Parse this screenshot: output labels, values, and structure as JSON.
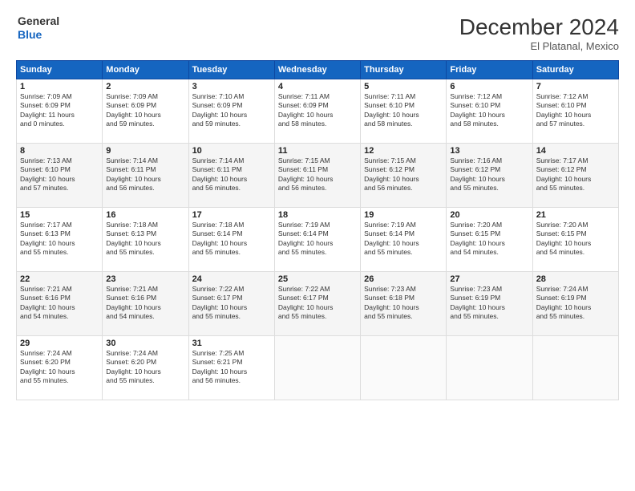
{
  "logo": {
    "line1": "General",
    "line2": "Blue"
  },
  "title": "December 2024",
  "location": "El Platanal, Mexico",
  "days_header": [
    "Sunday",
    "Monday",
    "Tuesday",
    "Wednesday",
    "Thursday",
    "Friday",
    "Saturday"
  ],
  "weeks": [
    [
      {
        "day": "1",
        "info": "Sunrise: 7:09 AM\nSunset: 6:09 PM\nDaylight: 11 hours\nand 0 minutes."
      },
      {
        "day": "2",
        "info": "Sunrise: 7:09 AM\nSunset: 6:09 PM\nDaylight: 10 hours\nand 59 minutes."
      },
      {
        "day": "3",
        "info": "Sunrise: 7:10 AM\nSunset: 6:09 PM\nDaylight: 10 hours\nand 59 minutes."
      },
      {
        "day": "4",
        "info": "Sunrise: 7:11 AM\nSunset: 6:09 PM\nDaylight: 10 hours\nand 58 minutes."
      },
      {
        "day": "5",
        "info": "Sunrise: 7:11 AM\nSunset: 6:10 PM\nDaylight: 10 hours\nand 58 minutes."
      },
      {
        "day": "6",
        "info": "Sunrise: 7:12 AM\nSunset: 6:10 PM\nDaylight: 10 hours\nand 58 minutes."
      },
      {
        "day": "7",
        "info": "Sunrise: 7:12 AM\nSunset: 6:10 PM\nDaylight: 10 hours\nand 57 minutes."
      }
    ],
    [
      {
        "day": "8",
        "info": "Sunrise: 7:13 AM\nSunset: 6:10 PM\nDaylight: 10 hours\nand 57 minutes."
      },
      {
        "day": "9",
        "info": "Sunrise: 7:14 AM\nSunset: 6:11 PM\nDaylight: 10 hours\nand 56 minutes."
      },
      {
        "day": "10",
        "info": "Sunrise: 7:14 AM\nSunset: 6:11 PM\nDaylight: 10 hours\nand 56 minutes."
      },
      {
        "day": "11",
        "info": "Sunrise: 7:15 AM\nSunset: 6:11 PM\nDaylight: 10 hours\nand 56 minutes."
      },
      {
        "day": "12",
        "info": "Sunrise: 7:15 AM\nSunset: 6:12 PM\nDaylight: 10 hours\nand 56 minutes."
      },
      {
        "day": "13",
        "info": "Sunrise: 7:16 AM\nSunset: 6:12 PM\nDaylight: 10 hours\nand 55 minutes."
      },
      {
        "day": "14",
        "info": "Sunrise: 7:17 AM\nSunset: 6:12 PM\nDaylight: 10 hours\nand 55 minutes."
      }
    ],
    [
      {
        "day": "15",
        "info": "Sunrise: 7:17 AM\nSunset: 6:13 PM\nDaylight: 10 hours\nand 55 minutes."
      },
      {
        "day": "16",
        "info": "Sunrise: 7:18 AM\nSunset: 6:13 PM\nDaylight: 10 hours\nand 55 minutes."
      },
      {
        "day": "17",
        "info": "Sunrise: 7:18 AM\nSunset: 6:14 PM\nDaylight: 10 hours\nand 55 minutes."
      },
      {
        "day": "18",
        "info": "Sunrise: 7:19 AM\nSunset: 6:14 PM\nDaylight: 10 hours\nand 55 minutes."
      },
      {
        "day": "19",
        "info": "Sunrise: 7:19 AM\nSunset: 6:14 PM\nDaylight: 10 hours\nand 55 minutes."
      },
      {
        "day": "20",
        "info": "Sunrise: 7:20 AM\nSunset: 6:15 PM\nDaylight: 10 hours\nand 54 minutes."
      },
      {
        "day": "21",
        "info": "Sunrise: 7:20 AM\nSunset: 6:15 PM\nDaylight: 10 hours\nand 54 minutes."
      }
    ],
    [
      {
        "day": "22",
        "info": "Sunrise: 7:21 AM\nSunset: 6:16 PM\nDaylight: 10 hours\nand 54 minutes."
      },
      {
        "day": "23",
        "info": "Sunrise: 7:21 AM\nSunset: 6:16 PM\nDaylight: 10 hours\nand 54 minutes."
      },
      {
        "day": "24",
        "info": "Sunrise: 7:22 AM\nSunset: 6:17 PM\nDaylight: 10 hours\nand 55 minutes."
      },
      {
        "day": "25",
        "info": "Sunrise: 7:22 AM\nSunset: 6:17 PM\nDaylight: 10 hours\nand 55 minutes."
      },
      {
        "day": "26",
        "info": "Sunrise: 7:23 AM\nSunset: 6:18 PM\nDaylight: 10 hours\nand 55 minutes."
      },
      {
        "day": "27",
        "info": "Sunrise: 7:23 AM\nSunset: 6:19 PM\nDaylight: 10 hours\nand 55 minutes."
      },
      {
        "day": "28",
        "info": "Sunrise: 7:24 AM\nSunset: 6:19 PM\nDaylight: 10 hours\nand 55 minutes."
      }
    ],
    [
      {
        "day": "29",
        "info": "Sunrise: 7:24 AM\nSunset: 6:20 PM\nDaylight: 10 hours\nand 55 minutes."
      },
      {
        "day": "30",
        "info": "Sunrise: 7:24 AM\nSunset: 6:20 PM\nDaylight: 10 hours\nand 55 minutes."
      },
      {
        "day": "31",
        "info": "Sunrise: 7:25 AM\nSunset: 6:21 PM\nDaylight: 10 hours\nand 56 minutes."
      },
      {
        "day": "",
        "info": ""
      },
      {
        "day": "",
        "info": ""
      },
      {
        "day": "",
        "info": ""
      },
      {
        "day": "",
        "info": ""
      }
    ]
  ]
}
